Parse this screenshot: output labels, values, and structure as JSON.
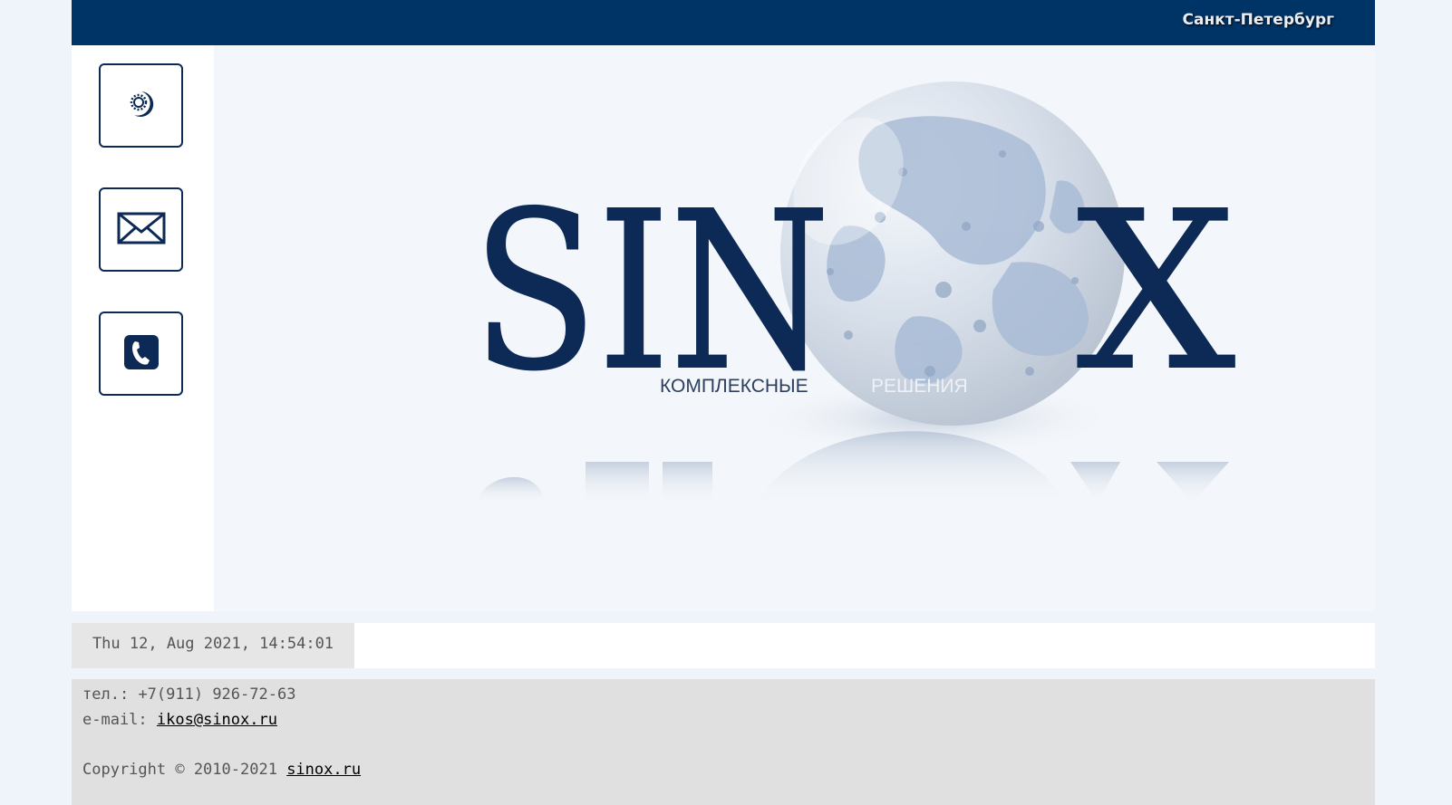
{
  "header": {
    "city": "Санкт-Петербург"
  },
  "sidebar": {
    "buttons": [
      {
        "icon": "moon-sun-icon"
      },
      {
        "icon": "envelope-icon"
      },
      {
        "icon": "phone-icon"
      }
    ]
  },
  "logo": {
    "wordmark_left": "SIN",
    "wordmark_right": "X",
    "tagline_left": "КОМПЛЕКСНЫЕ",
    "tagline_right": "РЕШЕНИЯ"
  },
  "status": {
    "datetime": "Thu 12, Aug 2021, 14:54:01"
  },
  "footer": {
    "phone_label": "тел.:",
    "phone": "+7(911) 926-72-63",
    "email_label": "e-mail:",
    "email": "ikos@sinox.ru",
    "copyright": "Copyright © 2010-2021",
    "site_link": "sinox.ru"
  },
  "colors": {
    "header_bg": "#003366",
    "accent": "#0c2a55",
    "page_bg": "#eef4fa"
  }
}
